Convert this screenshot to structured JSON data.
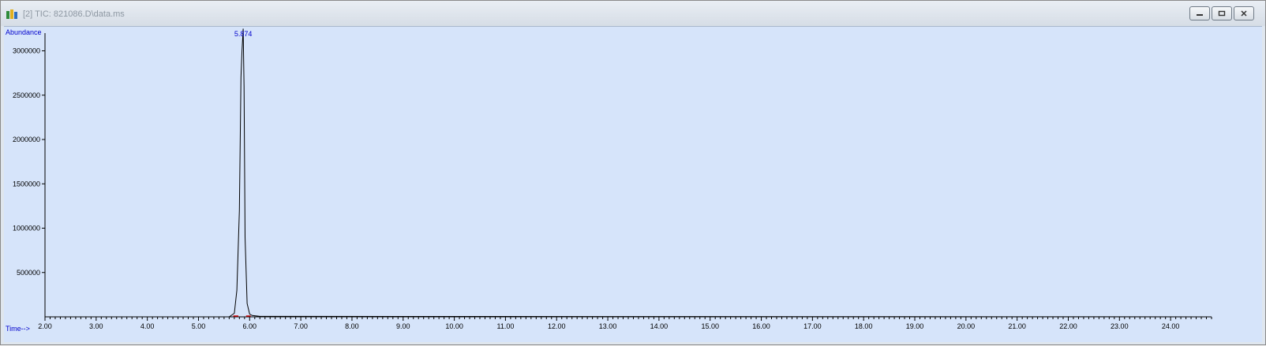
{
  "window": {
    "title": "[2] TIC: 821086.D\\data.ms",
    "icon": "chemstation-app-icon",
    "controls": [
      "minimize-icon",
      "restore-icon",
      "close-icon"
    ]
  },
  "chart_data": {
    "type": "line",
    "ylabel": "Abundance",
    "xlabel": "Time-->",
    "xlim": [
      2.0,
      24.8
    ],
    "ylim": [
      0,
      3200000
    ],
    "x_ticks": [
      "2.00",
      "3.00",
      "4.00",
      "5.00",
      "6.00",
      "7.00",
      "8.00",
      "9.00",
      "10.00",
      "11.00",
      "12.00",
      "13.00",
      "14.00",
      "15.00",
      "16.00",
      "17.00",
      "18.00",
      "19.00",
      "20.00",
      "21.00",
      "22.00",
      "23.00",
      "24.00"
    ],
    "y_ticks": [
      "500000",
      "1000000",
      "1500000",
      "2000000",
      "2500000",
      "3000000"
    ],
    "series": [
      {
        "x": [
          2.0,
          5.6,
          5.7,
          5.75,
          5.8,
          5.83,
          5.85,
          5.874,
          5.89,
          5.91,
          5.95,
          6.0,
          6.05,
          6.2,
          24.8
        ],
        "y": [
          0,
          0,
          40000,
          300000,
          1200000,
          2700000,
          3000000,
          3250000,
          2600000,
          900000,
          150000,
          30000,
          15000,
          5000,
          0
        ]
      }
    ],
    "annotations": [
      {
        "text": "5.874",
        "x": 5.874
      }
    ],
    "colors": {
      "trace": "#000000",
      "axis_label": "#0000cc",
      "background": "#d6e4fa",
      "integration_mark": "#cc0000"
    }
  }
}
